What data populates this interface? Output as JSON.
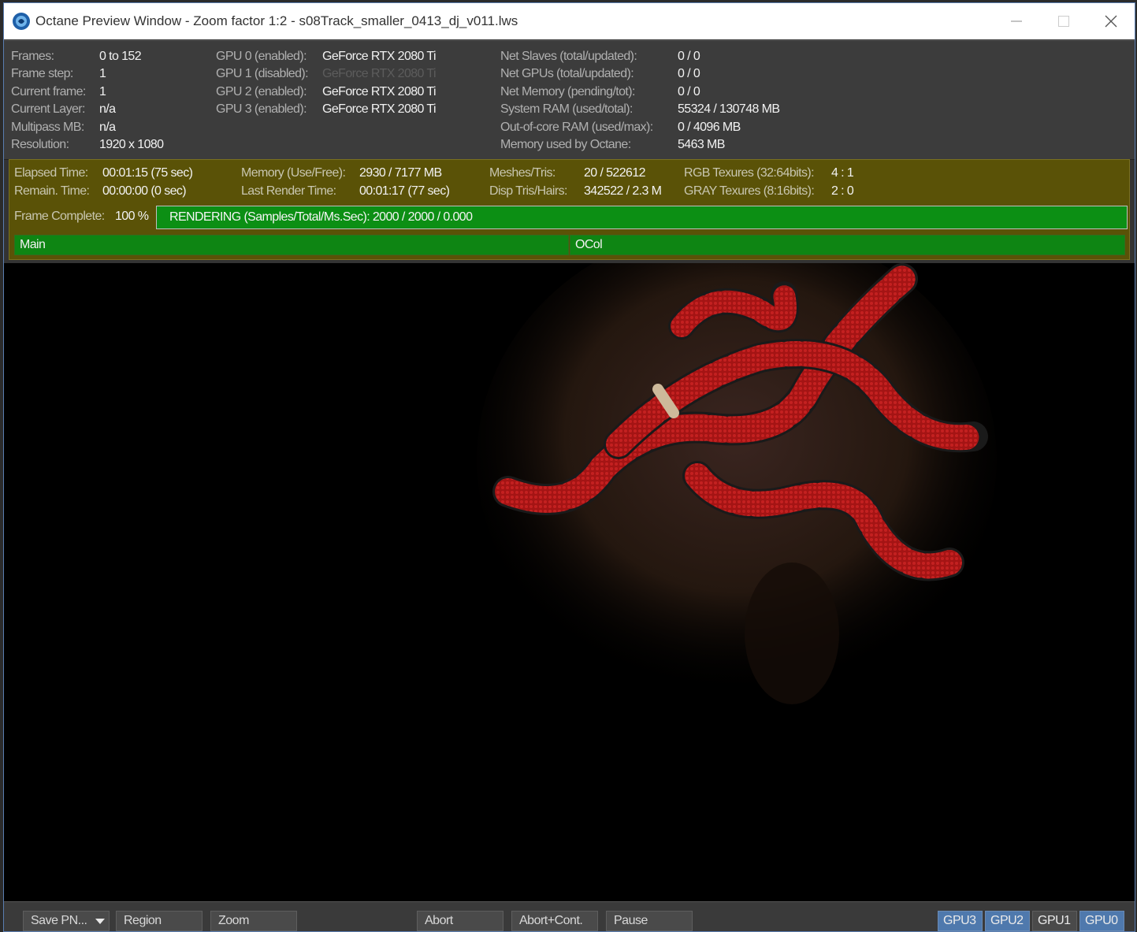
{
  "window": {
    "title": "Octane Preview Window - Zoom factor 1:2 - s08Track_smaller_0413_dj_v011.lws"
  },
  "stats": {
    "frames_label": "Frames:",
    "frames": "0 to 152",
    "frame_step_label": "Frame step:",
    "frame_step": "1",
    "current_frame_label": "Current frame:",
    "current_frame": "1",
    "current_layer_label": "Current Layer:",
    "current_layer": "n/a",
    "multipass_label": "Multipass MB:",
    "multipass": "n/a",
    "resolution_label": "Resolution:",
    "resolution": "1920 x 1080",
    "gpus": [
      {
        "label": "GPU  0 (enabled):",
        "name": "GeForce RTX 2080 Ti",
        "enabled": true
      },
      {
        "label": "GPU  1 (disabled):",
        "name": "GeForce RTX 2080 Ti",
        "enabled": false
      },
      {
        "label": "GPU  2 (enabled):",
        "name": "GeForce RTX 2080 Ti",
        "enabled": true
      },
      {
        "label": "GPU  3 (enabled):",
        "name": "GeForce RTX 2080 Ti",
        "enabled": true
      }
    ],
    "net_slaves_label": "Net Slaves (total/updated):",
    "net_slaves": "0 / 0",
    "net_gpus_label": "Net GPUs (total/updated):",
    "net_gpus": "0 / 0",
    "net_memory_label": "Net Memory (pending/tot):",
    "net_memory": "0 / 0",
    "system_ram_label": "System RAM (used/total):",
    "system_ram": "55324 / 130748 MB",
    "ooc_ram_label": "Out-of-core RAM (used/max):",
    "ooc_ram": "0 / 4096 MB",
    "octane_mem_label": "Memory used by Octane:",
    "octane_mem": "5463 MB"
  },
  "render": {
    "elapsed_label": "Elapsed Time:",
    "elapsed": "00:01:15 (75 sec)",
    "remain_label": "Remain. Time:",
    "remain": "00:00:00 (0 sec)",
    "memory_label": "Memory (Use/Free):",
    "memory": "2930 / 7177 MB",
    "last_render_label": "Last Render Time:",
    "last_render": "00:01:17 (77 sec)",
    "meshes_label": "Meshes/Tris:",
    "meshes": "20 / 522612",
    "disp_label": "Disp Tris/Hairs:",
    "disp": "342522 / 2.3 M",
    "rgb_tex_label": "RGB Texures (32:64bits):",
    "rgb_tex": "4 : 1",
    "gray_tex_label": "GRAY Texures (8:16bits):",
    "gray_tex": "2 : 0",
    "frame_complete_label": "Frame Complete:",
    "frame_complete": "100 %",
    "progress_fraction": 1.0,
    "progress_text": "RENDERING (Samples/Total/Ms.Sec): 2000 / 2000 / 0.000",
    "passes": [
      "Main",
      "OCol"
    ]
  },
  "toolbar": {
    "save": "Save PN...",
    "region": "Region",
    "zoom": "Zoom",
    "abort": "Abort",
    "abort_cont": "Abort+Cont.",
    "pause": "Pause",
    "gpu_buttons": [
      {
        "label": "GPU3",
        "on": true
      },
      {
        "label": "GPU2",
        "on": true
      },
      {
        "label": "GPU1",
        "on": false
      },
      {
        "label": "GPU0",
        "on": true
      }
    ]
  },
  "colors": {
    "render_panel": "#5a5207",
    "progress_green": "#0f8a16",
    "gpu_on": "#4f79ad",
    "snake_red": "#b01818"
  }
}
